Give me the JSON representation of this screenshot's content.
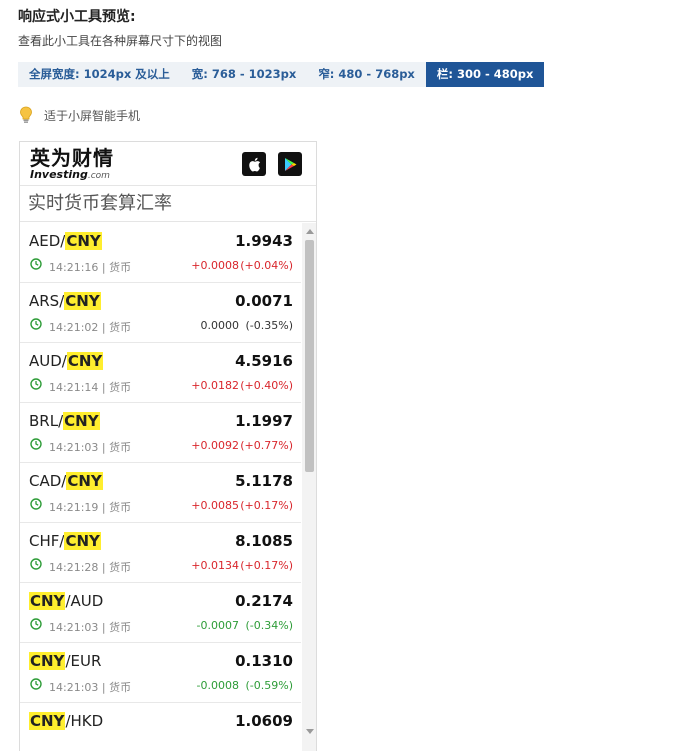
{
  "page": {
    "title": "响应式小工具预览:",
    "subtitle": "查看此小工具在各种屏幕尺寸下的视图"
  },
  "tabs": [
    {
      "label": "全屏宽度: 1024px 及以上",
      "active": false
    },
    {
      "label": "宽: 768 - 1023px",
      "active": false
    },
    {
      "label": "窄: 480 - 768px",
      "active": false
    },
    {
      "label": "栏: 300 - 480px",
      "active": true
    }
  ],
  "tip": {
    "text": "适于小屏智能手机",
    "icon": "lightbulb-icon"
  },
  "widget": {
    "logo_cn": "英为财情",
    "logo_en": "Investing",
    "logo_com": ".com",
    "heading": "实时货币套算汇率",
    "colors": {
      "up": "#d9262c",
      "down": "#2e9c38",
      "highlight": "#ffee2e",
      "accent": "#1f5597"
    },
    "rows": [
      {
        "base": "AED",
        "sep": "/",
        "quote": "CNY",
        "hl": "quote",
        "price": "1.9943",
        "time": "14:21:16 | 货币",
        "change": "+0.0008",
        "pct": "(+0.04%)",
        "dir": "up"
      },
      {
        "base": "ARS",
        "sep": "/",
        "quote": "CNY",
        "hl": "quote",
        "price": "0.0071",
        "time": "14:21:02 | 货币",
        "change": "0.0000",
        "pct": "(-0.35%)",
        "dir": "flat"
      },
      {
        "base": "AUD",
        "sep": "/",
        "quote": "CNY",
        "hl": "quote",
        "price": "4.5916",
        "time": "14:21:14 | 货币",
        "change": "+0.0182",
        "pct": "(+0.40%)",
        "dir": "up"
      },
      {
        "base": "BRL",
        "sep": "/",
        "quote": "CNY",
        "hl": "quote",
        "price": "1.1997",
        "time": "14:21:03 | 货币",
        "change": "+0.0092",
        "pct": "(+0.77%)",
        "dir": "up"
      },
      {
        "base": "CAD",
        "sep": "/",
        "quote": "CNY",
        "hl": "quote",
        "price": "5.1178",
        "time": "14:21:19 | 货币",
        "change": "+0.0085",
        "pct": "(+0.17%)",
        "dir": "up"
      },
      {
        "base": "CHF",
        "sep": "/",
        "quote": "CNY",
        "hl": "quote",
        "price": "8.1085",
        "time": "14:21:28 | 货币",
        "change": "+0.0134",
        "pct": "(+0.17%)",
        "dir": "up"
      },
      {
        "base": "CNY",
        "sep": "/",
        "quote": "AUD",
        "hl": "base",
        "price": "0.2174",
        "time": "14:21:03 | 货币",
        "change": "-0.0007",
        "pct": "(-0.34%)",
        "dir": "down"
      },
      {
        "base": "CNY",
        "sep": "/",
        "quote": "EUR",
        "hl": "base",
        "price": "0.1310",
        "time": "14:21:03 | 货币",
        "change": "-0.0008",
        "pct": "(-0.59%)",
        "dir": "down"
      },
      {
        "base": "CNY",
        "sep": "/",
        "quote": "HKD",
        "hl": "base",
        "price": "1.0609",
        "time": "",
        "change": "",
        "pct": "",
        "dir": "flat"
      }
    ]
  }
}
